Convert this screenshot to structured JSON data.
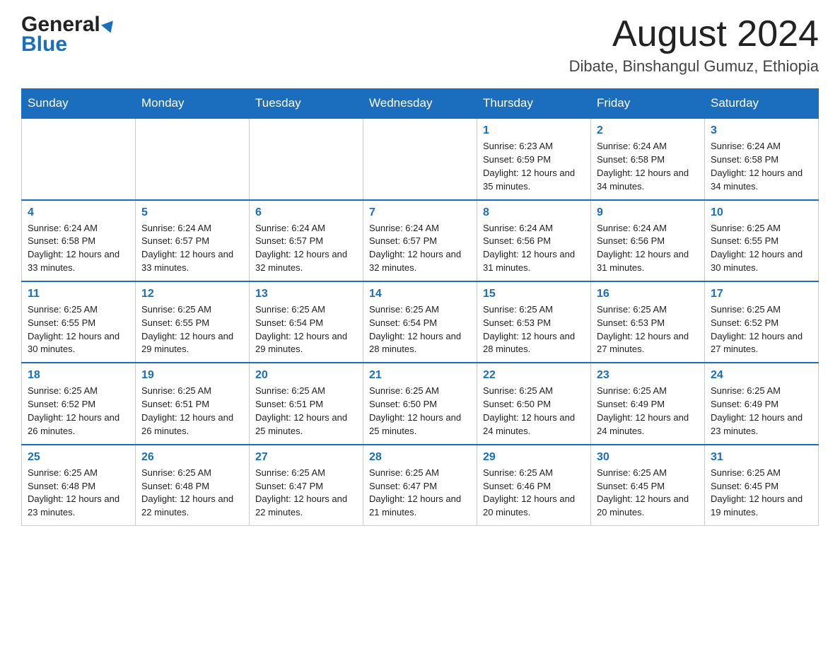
{
  "header": {
    "logo_general": "General",
    "logo_blue": "Blue",
    "month_title": "August 2024",
    "location": "Dibate, Binshangul Gumuz, Ethiopia"
  },
  "weekdays": [
    "Sunday",
    "Monday",
    "Tuesday",
    "Wednesday",
    "Thursday",
    "Friday",
    "Saturday"
  ],
  "weeks": [
    [
      {
        "day": "",
        "sunrise": "",
        "sunset": "",
        "daylight": ""
      },
      {
        "day": "",
        "sunrise": "",
        "sunset": "",
        "daylight": ""
      },
      {
        "day": "",
        "sunrise": "",
        "sunset": "",
        "daylight": ""
      },
      {
        "day": "",
        "sunrise": "",
        "sunset": "",
        "daylight": ""
      },
      {
        "day": "1",
        "sunrise": "Sunrise: 6:23 AM",
        "sunset": "Sunset: 6:59 PM",
        "daylight": "Daylight: 12 hours and 35 minutes."
      },
      {
        "day": "2",
        "sunrise": "Sunrise: 6:24 AM",
        "sunset": "Sunset: 6:58 PM",
        "daylight": "Daylight: 12 hours and 34 minutes."
      },
      {
        "day": "3",
        "sunrise": "Sunrise: 6:24 AM",
        "sunset": "Sunset: 6:58 PM",
        "daylight": "Daylight: 12 hours and 34 minutes."
      }
    ],
    [
      {
        "day": "4",
        "sunrise": "Sunrise: 6:24 AM",
        "sunset": "Sunset: 6:58 PM",
        "daylight": "Daylight: 12 hours and 33 minutes."
      },
      {
        "day": "5",
        "sunrise": "Sunrise: 6:24 AM",
        "sunset": "Sunset: 6:57 PM",
        "daylight": "Daylight: 12 hours and 33 minutes."
      },
      {
        "day": "6",
        "sunrise": "Sunrise: 6:24 AM",
        "sunset": "Sunset: 6:57 PM",
        "daylight": "Daylight: 12 hours and 32 minutes."
      },
      {
        "day": "7",
        "sunrise": "Sunrise: 6:24 AM",
        "sunset": "Sunset: 6:57 PM",
        "daylight": "Daylight: 12 hours and 32 minutes."
      },
      {
        "day": "8",
        "sunrise": "Sunrise: 6:24 AM",
        "sunset": "Sunset: 6:56 PM",
        "daylight": "Daylight: 12 hours and 31 minutes."
      },
      {
        "day": "9",
        "sunrise": "Sunrise: 6:24 AM",
        "sunset": "Sunset: 6:56 PM",
        "daylight": "Daylight: 12 hours and 31 minutes."
      },
      {
        "day": "10",
        "sunrise": "Sunrise: 6:25 AM",
        "sunset": "Sunset: 6:55 PM",
        "daylight": "Daylight: 12 hours and 30 minutes."
      }
    ],
    [
      {
        "day": "11",
        "sunrise": "Sunrise: 6:25 AM",
        "sunset": "Sunset: 6:55 PM",
        "daylight": "Daylight: 12 hours and 30 minutes."
      },
      {
        "day": "12",
        "sunrise": "Sunrise: 6:25 AM",
        "sunset": "Sunset: 6:55 PM",
        "daylight": "Daylight: 12 hours and 29 minutes."
      },
      {
        "day": "13",
        "sunrise": "Sunrise: 6:25 AM",
        "sunset": "Sunset: 6:54 PM",
        "daylight": "Daylight: 12 hours and 29 minutes."
      },
      {
        "day": "14",
        "sunrise": "Sunrise: 6:25 AM",
        "sunset": "Sunset: 6:54 PM",
        "daylight": "Daylight: 12 hours and 28 minutes."
      },
      {
        "day": "15",
        "sunrise": "Sunrise: 6:25 AM",
        "sunset": "Sunset: 6:53 PM",
        "daylight": "Daylight: 12 hours and 28 minutes."
      },
      {
        "day": "16",
        "sunrise": "Sunrise: 6:25 AM",
        "sunset": "Sunset: 6:53 PM",
        "daylight": "Daylight: 12 hours and 27 minutes."
      },
      {
        "day": "17",
        "sunrise": "Sunrise: 6:25 AM",
        "sunset": "Sunset: 6:52 PM",
        "daylight": "Daylight: 12 hours and 27 minutes."
      }
    ],
    [
      {
        "day": "18",
        "sunrise": "Sunrise: 6:25 AM",
        "sunset": "Sunset: 6:52 PM",
        "daylight": "Daylight: 12 hours and 26 minutes."
      },
      {
        "day": "19",
        "sunrise": "Sunrise: 6:25 AM",
        "sunset": "Sunset: 6:51 PM",
        "daylight": "Daylight: 12 hours and 26 minutes."
      },
      {
        "day": "20",
        "sunrise": "Sunrise: 6:25 AM",
        "sunset": "Sunset: 6:51 PM",
        "daylight": "Daylight: 12 hours and 25 minutes."
      },
      {
        "day": "21",
        "sunrise": "Sunrise: 6:25 AM",
        "sunset": "Sunset: 6:50 PM",
        "daylight": "Daylight: 12 hours and 25 minutes."
      },
      {
        "day": "22",
        "sunrise": "Sunrise: 6:25 AM",
        "sunset": "Sunset: 6:50 PM",
        "daylight": "Daylight: 12 hours and 24 minutes."
      },
      {
        "day": "23",
        "sunrise": "Sunrise: 6:25 AM",
        "sunset": "Sunset: 6:49 PM",
        "daylight": "Daylight: 12 hours and 24 minutes."
      },
      {
        "day": "24",
        "sunrise": "Sunrise: 6:25 AM",
        "sunset": "Sunset: 6:49 PM",
        "daylight": "Daylight: 12 hours and 23 minutes."
      }
    ],
    [
      {
        "day": "25",
        "sunrise": "Sunrise: 6:25 AM",
        "sunset": "Sunset: 6:48 PM",
        "daylight": "Daylight: 12 hours and 23 minutes."
      },
      {
        "day": "26",
        "sunrise": "Sunrise: 6:25 AM",
        "sunset": "Sunset: 6:48 PM",
        "daylight": "Daylight: 12 hours and 22 minutes."
      },
      {
        "day": "27",
        "sunrise": "Sunrise: 6:25 AM",
        "sunset": "Sunset: 6:47 PM",
        "daylight": "Daylight: 12 hours and 22 minutes."
      },
      {
        "day": "28",
        "sunrise": "Sunrise: 6:25 AM",
        "sunset": "Sunset: 6:47 PM",
        "daylight": "Daylight: 12 hours and 21 minutes."
      },
      {
        "day": "29",
        "sunrise": "Sunrise: 6:25 AM",
        "sunset": "Sunset: 6:46 PM",
        "daylight": "Daylight: 12 hours and 20 minutes."
      },
      {
        "day": "30",
        "sunrise": "Sunrise: 6:25 AM",
        "sunset": "Sunset: 6:45 PM",
        "daylight": "Daylight: 12 hours and 20 minutes."
      },
      {
        "day": "31",
        "sunrise": "Sunrise: 6:25 AM",
        "sunset": "Sunset: 6:45 PM",
        "daylight": "Daylight: 12 hours and 19 minutes."
      }
    ]
  ]
}
